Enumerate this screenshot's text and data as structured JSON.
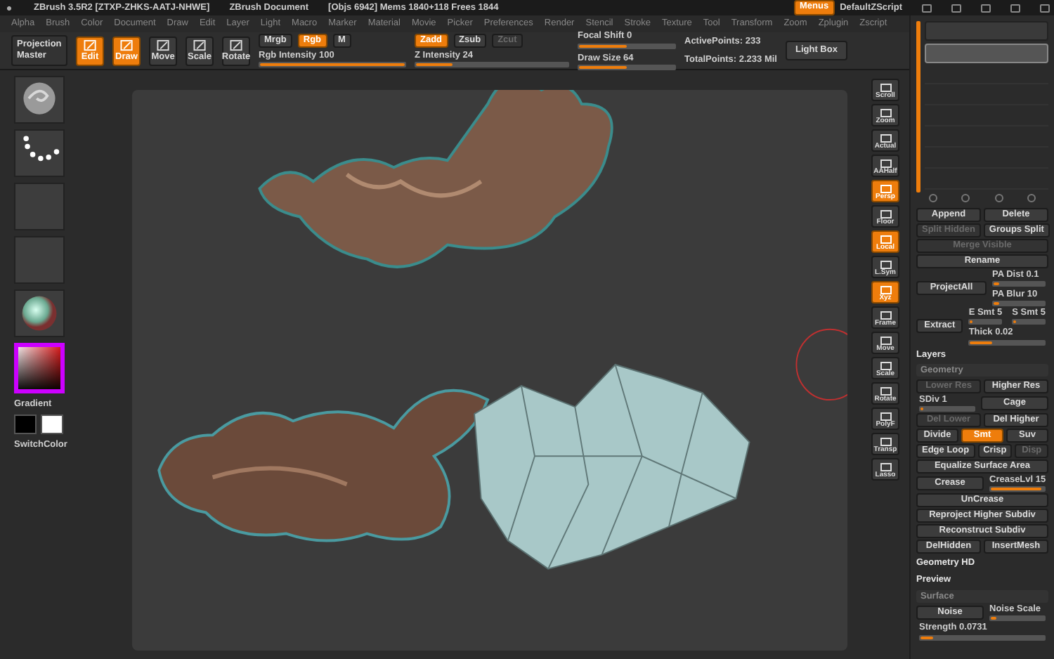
{
  "title_bar": {
    "app": "ZBrush 3.5R2 [ZTXP-ZHKS-AATJ-NHWE]",
    "document": "ZBrush Document",
    "stats": "[Objs 6942] Mems 1840+118 Frees 1844",
    "menus_button": {
      "label": "Menus",
      "selected": true
    },
    "script": "DefaultZScript"
  },
  "menu_bar": [
    "Alpha",
    "Brush",
    "Color",
    "Document",
    "Draw",
    "Edit",
    "Layer",
    "Light",
    "Macro",
    "Marker",
    "Material",
    "Movie",
    "Picker",
    "Preferences",
    "Render",
    "Stencil",
    "Stroke",
    "Texture",
    "Tool",
    "Transform",
    "Zoom",
    "Zplugin",
    "Zscript"
  ],
  "toolbar": {
    "projection": "Projection Master",
    "modes": [
      {
        "label": "Edit",
        "selected": true
      },
      {
        "label": "Draw",
        "selected": true
      },
      {
        "label": "Move",
        "selected": false
      },
      {
        "label": "Scale",
        "selected": false
      },
      {
        "label": "Rotate",
        "selected": false
      }
    ],
    "channels": [
      {
        "label": "Mrgb",
        "selected": false
      },
      {
        "label": "Rgb",
        "selected": true
      },
      {
        "label": "M",
        "selected": false
      }
    ],
    "rgb_intensity": {
      "label": "Rgb Intensity 100",
      "level": 1
    },
    "z_modes": [
      {
        "label": "Zadd",
        "selected": true,
        "disabled": false
      },
      {
        "label": "Zsub",
        "selected": false,
        "disabled": false
      },
      {
        "label": "Zcut",
        "selected": false,
        "disabled": true
      }
    ],
    "z_intensity": {
      "label": "Z Intensity 24",
      "level": 0.24
    },
    "focal_shift": {
      "label": "Focal Shift 0",
      "level": 0.5
    },
    "draw_size": {
      "label": "Draw Size 64",
      "level": 0.5
    },
    "active_points": "ActivePoints: 233",
    "total_points": "TotalPoints: 2.233 Mil",
    "light_box": "Light Box"
  },
  "left_panel": {
    "gradient_label": "Gradient",
    "switch_label": "SwitchColor"
  },
  "shelf": [
    {
      "label": "Scroll",
      "selected": false
    },
    {
      "label": "Zoom",
      "selected": false
    },
    {
      "label": "Actual",
      "selected": false
    },
    {
      "label": "AAHalf",
      "selected": false
    },
    {
      "label": "Persp",
      "selected": true
    },
    {
      "label": "Floor",
      "selected": false
    },
    {
      "label": "Local",
      "selected": true
    },
    {
      "label": "L.Sym",
      "selected": false
    },
    {
      "label": "Xyz",
      "selected": true
    },
    {
      "label": "Frame",
      "selected": false
    },
    {
      "label": "Move",
      "selected": false
    },
    {
      "label": "Scale",
      "selected": false
    },
    {
      "label": "Rotate",
      "selected": false
    },
    {
      "label": "PolyF",
      "selected": false
    },
    {
      "label": "Transp",
      "selected": false
    },
    {
      "label": "Lasso",
      "selected": false
    }
  ],
  "subtools": [
    {
      "selected": false
    },
    {
      "selected": true
    }
  ],
  "panel_rows": [
    {
      "items": [
        {
          "kind": "button",
          "label": "Append",
          "selected": false,
          "disabled": false
        },
        {
          "kind": "button",
          "label": "Delete",
          "selected": false,
          "disabled": false
        }
      ]
    },
    {
      "items": [
        {
          "kind": "button",
          "label": "Split Hidden",
          "selected": false,
          "disabled": true
        },
        {
          "kind": "button",
          "label": "Groups Split",
          "selected": false,
          "disabled": false
        }
      ]
    },
    {
      "items": [
        {
          "kind": "button",
          "label": "Merge Visible",
          "selected": false,
          "disabled": true
        }
      ]
    },
    {
      "items": [
        {
          "kind": "button",
          "label": "Rename",
          "selected": false,
          "disabled": false
        }
      ]
    },
    {
      "items": [
        {
          "kind": "button",
          "label": "ProjectAll",
          "selected": false,
          "disabled": false
        },
        {
          "kind": "stack",
          "items": [
            {
              "kind": "slider",
              "label": "PA Dist 0.1",
              "level": 0.1
            },
            {
              "kind": "slider",
              "label": "PA Blur 10",
              "level": 0.1
            }
          ]
        }
      ]
    },
    {
      "items": [
        {
          "kind": "button",
          "label": "Extract",
          "selected": false,
          "disabled": false
        },
        {
          "kind": "stack",
          "items": [
            {
              "kind": "pair",
              "items": [
                {
                  "kind": "slider",
                  "label": "E Smt 5",
                  "level": 0.1
                },
                {
                  "kind": "slider",
                  "label": "S Smt 5",
                  "level": 0.1
                }
              ]
            },
            {
              "kind": "slider",
              "label": "Thick 0.02",
              "level": 0.3
            }
          ]
        }
      ]
    },
    {
      "items": [
        {
          "kind": "header",
          "label": "Layers"
        }
      ]
    },
    {
      "items": [
        {
          "kind": "subheader",
          "label": "Geometry"
        }
      ]
    },
    {
      "items": [
        {
          "kind": "button",
          "label": "Lower Res",
          "selected": false,
          "disabled": true
        },
        {
          "kind": "button",
          "label": "Higher Res",
          "selected": false,
          "disabled": false
        }
      ]
    },
    {
      "items": [
        {
          "kind": "slider",
          "label": "SDiv 1",
          "level": 0.05
        },
        {
          "kind": "button",
          "label": "Cage",
          "selected": false,
          "disabled": false
        }
      ]
    },
    {
      "items": [
        {
          "kind": "button",
          "label": "Del Lower",
          "selected": false,
          "disabled": true
        },
        {
          "kind": "button",
          "label": "Del Higher",
          "selected": false,
          "disabled": false
        }
      ]
    },
    {
      "items": [
        {
          "kind": "button",
          "label": "Divide",
          "selected": false,
          "disabled": false
        },
        {
          "kind": "button",
          "label": "Smt",
          "selected": true,
          "disabled": false
        },
        {
          "kind": "button",
          "label": "Suv",
          "selected": false,
          "disabled": false
        }
      ]
    },
    {
      "items": [
        {
          "kind": "button",
          "label": "Edge Loop",
          "selected": false,
          "disabled": false
        },
        {
          "kind": "button",
          "label": "Crisp",
          "selected": false,
          "disabled": false
        },
        {
          "kind": "button",
          "label": "Disp",
          "selected": false,
          "disabled": true
        }
      ]
    },
    {
      "items": [
        {
          "kind": "button",
          "label": "Equalize Surface Area",
          "selected": false,
          "disabled": false
        }
      ]
    },
    {
      "items": [
        {
          "kind": "button",
          "label": "Crease",
          "selected": false,
          "disabled": false
        },
        {
          "kind": "slider",
          "label": "CreaseLvl 15",
          "level": 0.95
        }
      ]
    },
    {
      "items": [
        {
          "kind": "button",
          "label": "UnCrease",
          "selected": false,
          "disabled": false
        }
      ]
    },
    {
      "items": [
        {
          "kind": "button",
          "label": "Reproject Higher Subdiv",
          "selected": false,
          "disabled": false
        }
      ]
    },
    {
      "items": [
        {
          "kind": "button",
          "label": "Reconstruct Subdiv",
          "selected": false,
          "disabled": false
        }
      ]
    },
    {
      "items": [
        {
          "kind": "button",
          "label": "DelHidden",
          "selected": false,
          "disabled": false
        },
        {
          "kind": "button",
          "label": "InsertMesh",
          "selected": false,
          "disabled": false
        }
      ]
    },
    {
      "items": [
        {
          "kind": "header",
          "label": "Geometry HD"
        }
      ]
    },
    {
      "items": [
        {
          "kind": "header",
          "label": "Preview"
        }
      ]
    },
    {
      "items": [
        {
          "kind": "subheader",
          "label": "Surface"
        }
      ]
    },
    {
      "items": [
        {
          "kind": "button",
          "label": "Noise",
          "selected": false,
          "disabled": false
        },
        {
          "kind": "slider",
          "label": "Noise Scale",
          "level": 0.1
        }
      ]
    },
    {
      "items": [
        {
          "kind": "slider",
          "label": "Strength 0.0731",
          "level": 0.1
        }
      ]
    }
  ]
}
